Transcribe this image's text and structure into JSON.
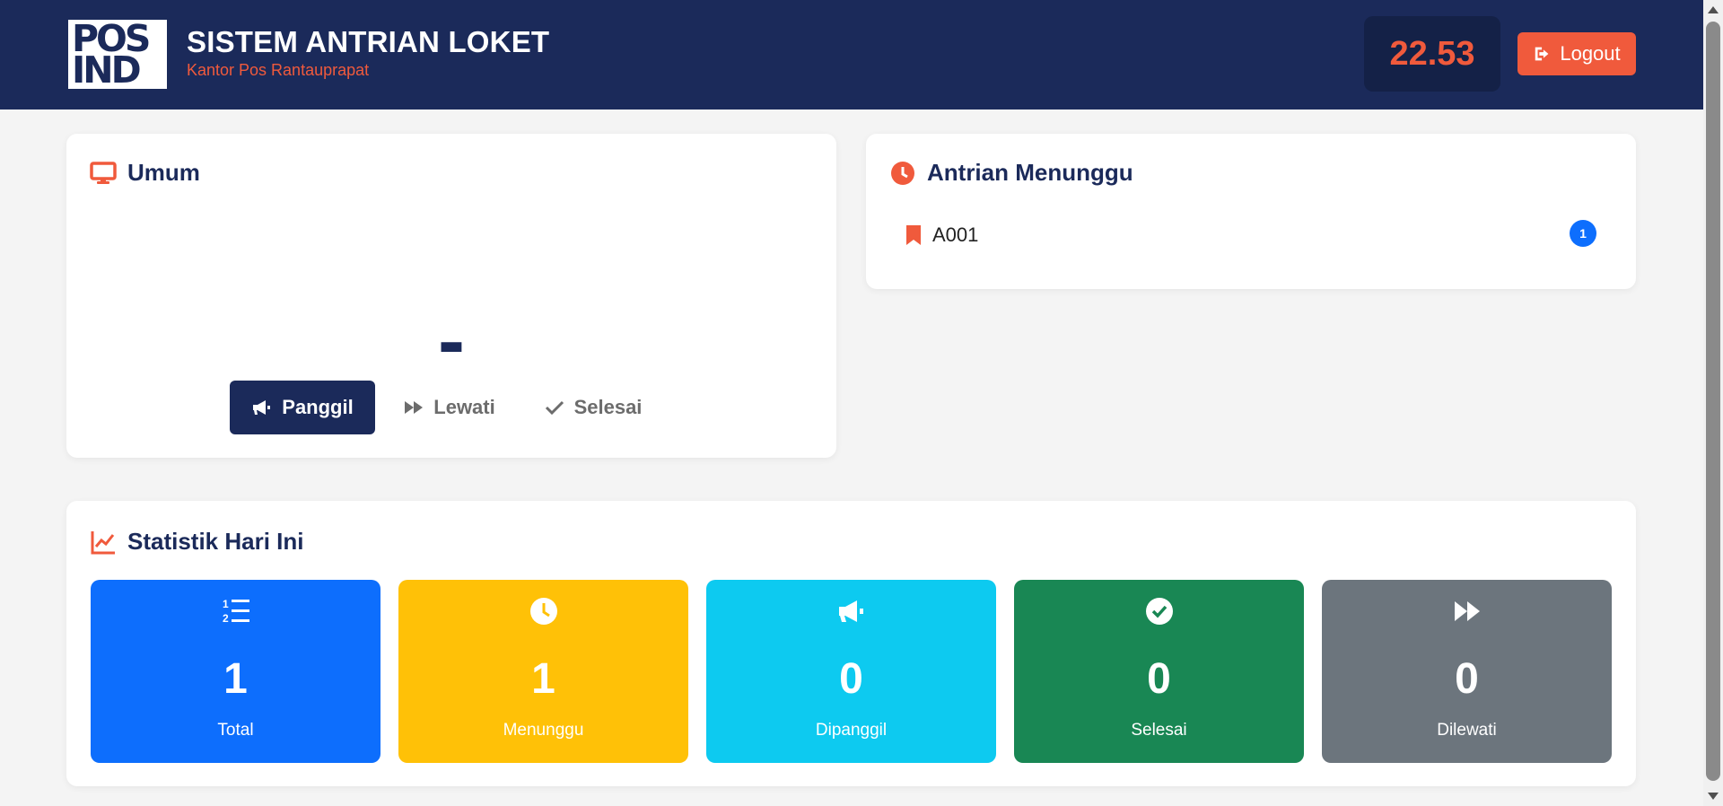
{
  "header": {
    "logo_line1": "POS",
    "logo_line2": "IND",
    "title": "SISTEM ANTRIAN LOKET",
    "subtitle": "Kantor Pos Rantauprapat",
    "clock": "22.53",
    "logout_label": "Logout",
    "logout_icon": "sign-out-icon"
  },
  "umum": {
    "title": "Umum",
    "title_icon": "desktop-icon",
    "current_number": "-",
    "buttons": {
      "call_label": "Panggil",
      "skip_label": "Lewati",
      "done_label": "Selesai"
    }
  },
  "antrian": {
    "title": "Antrian Menunggu",
    "title_icon": "clock-icon",
    "items": [
      {
        "code": "A001",
        "badge": "1",
        "icon": "bookmark-icon"
      }
    ]
  },
  "statistik": {
    "title": "Statistik Hari Ini",
    "title_icon": "chart-line-icon",
    "cards": [
      {
        "value": "1",
        "label": "Total",
        "color": "#0d6efd",
        "icon": "list-ol-icon"
      },
      {
        "value": "1",
        "label": "Menunggu",
        "color": "#ffc107",
        "icon": "clock-icon"
      },
      {
        "value": "0",
        "label": "Dipanggil",
        "color": "#0dcaf0",
        "icon": "bullhorn-icon"
      },
      {
        "value": "0",
        "label": "Selesai",
        "color": "#198754",
        "icon": "check-circle-icon"
      },
      {
        "value": "0",
        "label": "Dilewati",
        "color": "#6c757d",
        "icon": "forward-icon"
      }
    ]
  },
  "colors": {
    "navy": "#1b2a5a",
    "accent": "#f05a3c",
    "background": "#f4f4f4"
  }
}
